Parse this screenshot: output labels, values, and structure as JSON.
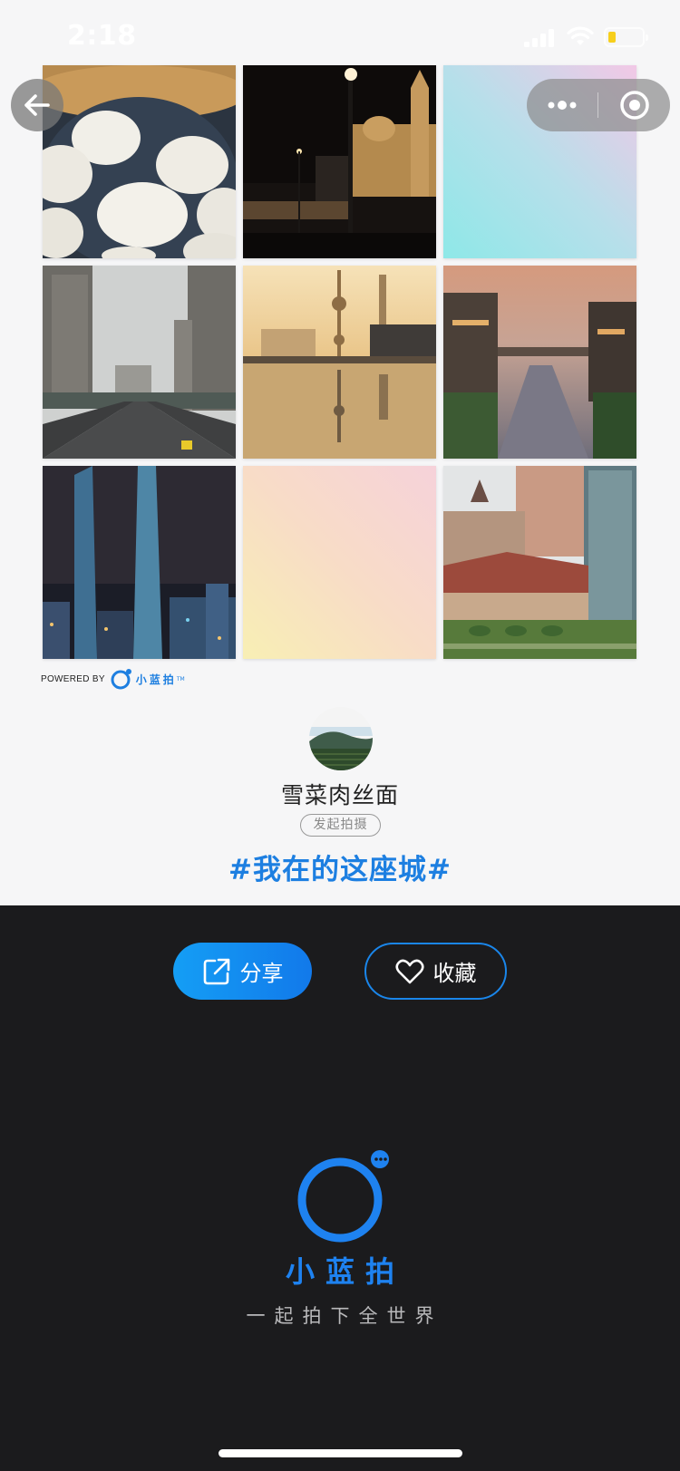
{
  "status_bar": {
    "time": "2:18",
    "battery_level": 0.15,
    "battery_color": "#f7cf1c"
  },
  "nav": {
    "back_icon": "arrow-left-icon",
    "more_icon": "more-dots-icon",
    "close_icon": "target-circle-icon"
  },
  "photo_grid": {
    "cells": [
      {
        "subject": "soup-dumplings"
      },
      {
        "subject": "bund-night-clock-tower"
      },
      {
        "subject": "blank-cyan-gradient"
      },
      {
        "subject": "city-highway-towers"
      },
      {
        "subject": "oriental-pearl-tower-sunrise"
      },
      {
        "subject": "water-town-canal-dusk"
      },
      {
        "subject": "lujiazui-skyscrapers-night"
      },
      {
        "subject": "blank-yellow-pink-gradient"
      },
      {
        "subject": "historic-villa-garden"
      }
    ]
  },
  "powered_by": {
    "label": "POWERED BY",
    "brand": "小蓝拍",
    "tm": "TM"
  },
  "author": {
    "name": "雪菜肉丝面",
    "role_tag": "发起拍摄"
  },
  "topic": "#我在的这座城#",
  "actions": {
    "share_label": "分享",
    "share_icon": "share-external-icon",
    "favorite_label": "收藏",
    "favorite_icon": "heart-outline-icon"
  },
  "footer": {
    "brand_name": "小蓝拍",
    "slogan": "一起拍下全世界",
    "accent_color": "#1e82f0"
  }
}
